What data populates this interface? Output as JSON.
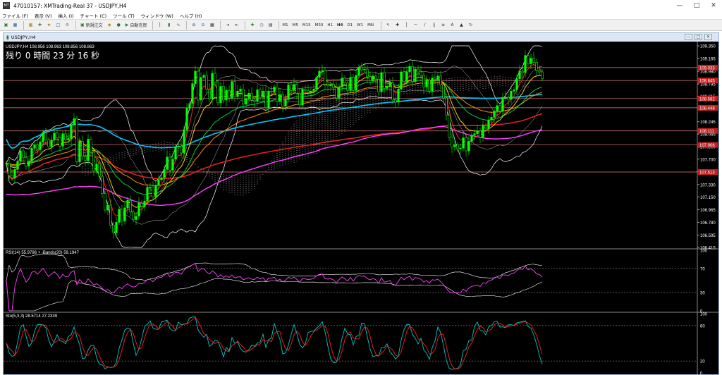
{
  "window": {
    "title": "47010157: XMTrading-Real 37 - USDJPY,H4",
    "app_icon_text": "MT"
  },
  "menu": [
    "ファイル (F)",
    "表示 (V)",
    "挿入 (I)",
    "チャート (C)",
    "ツール (T)",
    "ウィンドウ (W)",
    "ヘルプ (H)"
  ],
  "toolbar": {
    "new_order": "新規注文",
    "auto_trade": "自動売買",
    "timeframes": [
      "M1",
      "M5",
      "M15",
      "M30",
      "H1",
      "H4",
      "D1",
      "W1",
      "MN"
    ],
    "text_tool": "A"
  },
  "chart_window": {
    "tab_label": "USDJPY,H4"
  },
  "colors": {
    "ema_short": "#ff2020",
    "ema_mid": "#ffd000",
    "ema_long": "#00cc44",
    "ema_200": "#ff8c00",
    "sma_cyan": "#00c8ff",
    "sma_pink": "#ff40ff",
    "sma_red": "#e02020",
    "bollinger": "#ffffff",
    "candle_up": "#00ff00",
    "level_line": "#ff9090"
  },
  "chart_data": [
    {
      "type": "candlestick",
      "symbol": "USDJPY",
      "timeframe": "H4",
      "header": "USDJPY,H4  108.956 108.963 108.856 108.863",
      "countdown": "残り 0 時間 23 分 16 秒",
      "y_ticks": [
        "109.350",
        "109.165",
        "108.980",
        "108.795",
        "108.615",
        "108.430",
        "108.245",
        "108.065",
        "107.880",
        "107.700",
        "107.520",
        "107.330",
        "107.150",
        "106.965",
        "106.780",
        "106.595",
        "106.415"
      ],
      "ylim": [
        106.415,
        109.35
      ],
      "price_labels": [
        "109.033",
        "108.845",
        "108.582",
        "108.448",
        "108.111",
        "107.906",
        "107.513"
      ],
      "close": [
        107.64,
        107.46,
        107.43,
        107.55,
        107.67,
        107.82,
        107.72,
        107.6,
        107.67,
        107.86,
        107.91,
        107.84,
        107.95,
        108.08,
        107.98,
        107.88,
        107.98,
        108.08,
        108.01,
        107.89,
        108.07,
        107.98,
        108.0,
        108.2,
        108.29,
        107.66,
        107.96,
        107.74,
        107.68,
        107.99,
        107.8,
        107.53,
        107.63,
        107.45,
        107.2,
        106.96,
        107.03,
        106.74,
        106.63,
        106.78,
        106.97,
        106.8,
        106.99,
        107.1,
        106.93,
        106.82,
        106.87,
        107.06,
        107.01,
        107.09,
        107.29,
        107.29,
        107.15,
        107.32,
        107.4,
        107.43,
        107.55,
        107.73,
        107.54,
        107.7,
        107.88,
        107.89,
        107.79,
        108.13,
        108.44,
        108.51,
        108.8,
        108.98,
        108.56,
        108.89,
        108.92,
        108.72,
        108.58,
        108.95,
        108.82,
        108.52,
        108.76,
        108.56,
        108.7,
        108.59,
        108.83,
        108.61,
        108.69,
        108.72,
        108.5,
        108.58,
        108.66,
        108.56,
        108.54,
        108.71,
        108.6,
        108.69,
        108.45,
        108.69,
        108.68,
        108.75,
        108.54,
        108.64,
        108.47,
        108.57,
        108.78,
        108.7,
        108.79,
        108.66,
        108.49,
        108.72,
        108.7,
        108.67,
        108.69,
        108.72,
        108.89,
        108.98,
        108.99,
        108.79,
        108.77,
        108.79,
        108.74,
        108.59,
        108.75,
        108.88,
        108.81,
        108.7,
        108.89,
        108.7,
        108.92,
        109.04,
        109.0,
        109.01,
        108.9,
        108.84,
        108.91,
        108.86,
        108.68,
        108.96,
        108.73,
        108.76,
        108.81,
        108.56,
        108.53,
        108.72,
        108.97,
        108.83,
        108.97,
        109.05,
        108.83,
        109.01,
        108.97,
        108.92,
        108.75,
        108.85,
        108.69,
        108.88,
        108.86,
        108.91,
        108.78,
        108.59,
        108.34,
        108.02,
        107.88,
        107.91,
        107.85,
        107.86,
        108.01,
        107.82,
        107.96,
        108.05,
        108.07,
        108.11,
        108.02,
        108.19,
        108.15,
        108.27,
        108.31,
        108.4,
        108.48,
        108.4,
        108.6,
        108.6,
        108.57,
        108.69,
        108.71,
        108.87,
        108.98,
        108.96,
        109.21,
        109.09,
        109.17,
        109.11,
        108.99,
        108.97,
        108.87
      ]
    },
    {
      "type": "line",
      "header": "RSI(14) 55.9796  + -Bands(20) 59.1947",
      "y_ticks": [
        "100",
        "70",
        "30",
        "0"
      ],
      "ylim": [
        0,
        100
      ]
    },
    {
      "type": "line",
      "header": "Sto(5,3,3) 28.5714 27.2339",
      "y_ticks": [
        "100",
        "80",
        "20",
        "0"
      ],
      "ylim": [
        0,
        100
      ]
    }
  ]
}
